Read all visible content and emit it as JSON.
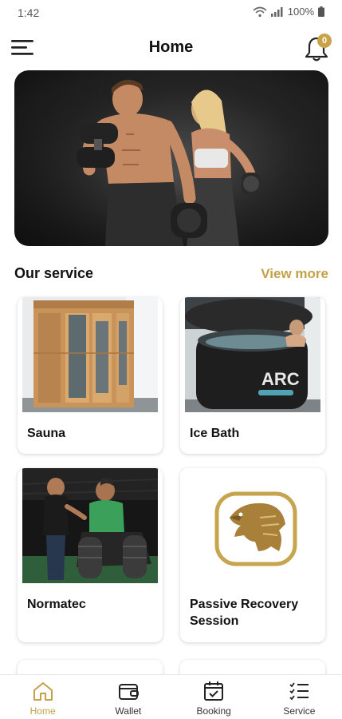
{
  "status_bar": {
    "time": "1:42",
    "battery": "100%",
    "signal": "VoLTE"
  },
  "header": {
    "title": "Home",
    "notification_count": "0"
  },
  "section": {
    "title": "Our service",
    "view_more": "View more"
  },
  "services": [
    {
      "label": "Sauna",
      "icon": "sauna-photo"
    },
    {
      "label": "Ice Bath",
      "icon": "ice-bath-photo"
    },
    {
      "label": "Normatec",
      "icon": "normatec-photo"
    },
    {
      "label": "Passive Recovery Session",
      "icon": "eagle-logo"
    }
  ],
  "nav": [
    {
      "label": "Home",
      "icon": "home-icon",
      "active": true
    },
    {
      "label": "Wallet",
      "icon": "wallet-icon",
      "active": false
    },
    {
      "label": "Booking",
      "icon": "calendar-icon",
      "active": false
    },
    {
      "label": "Service",
      "icon": "list-icon",
      "active": false
    }
  ],
  "colors": {
    "accent": "#c4a048",
    "badge": "#c9a24a"
  }
}
